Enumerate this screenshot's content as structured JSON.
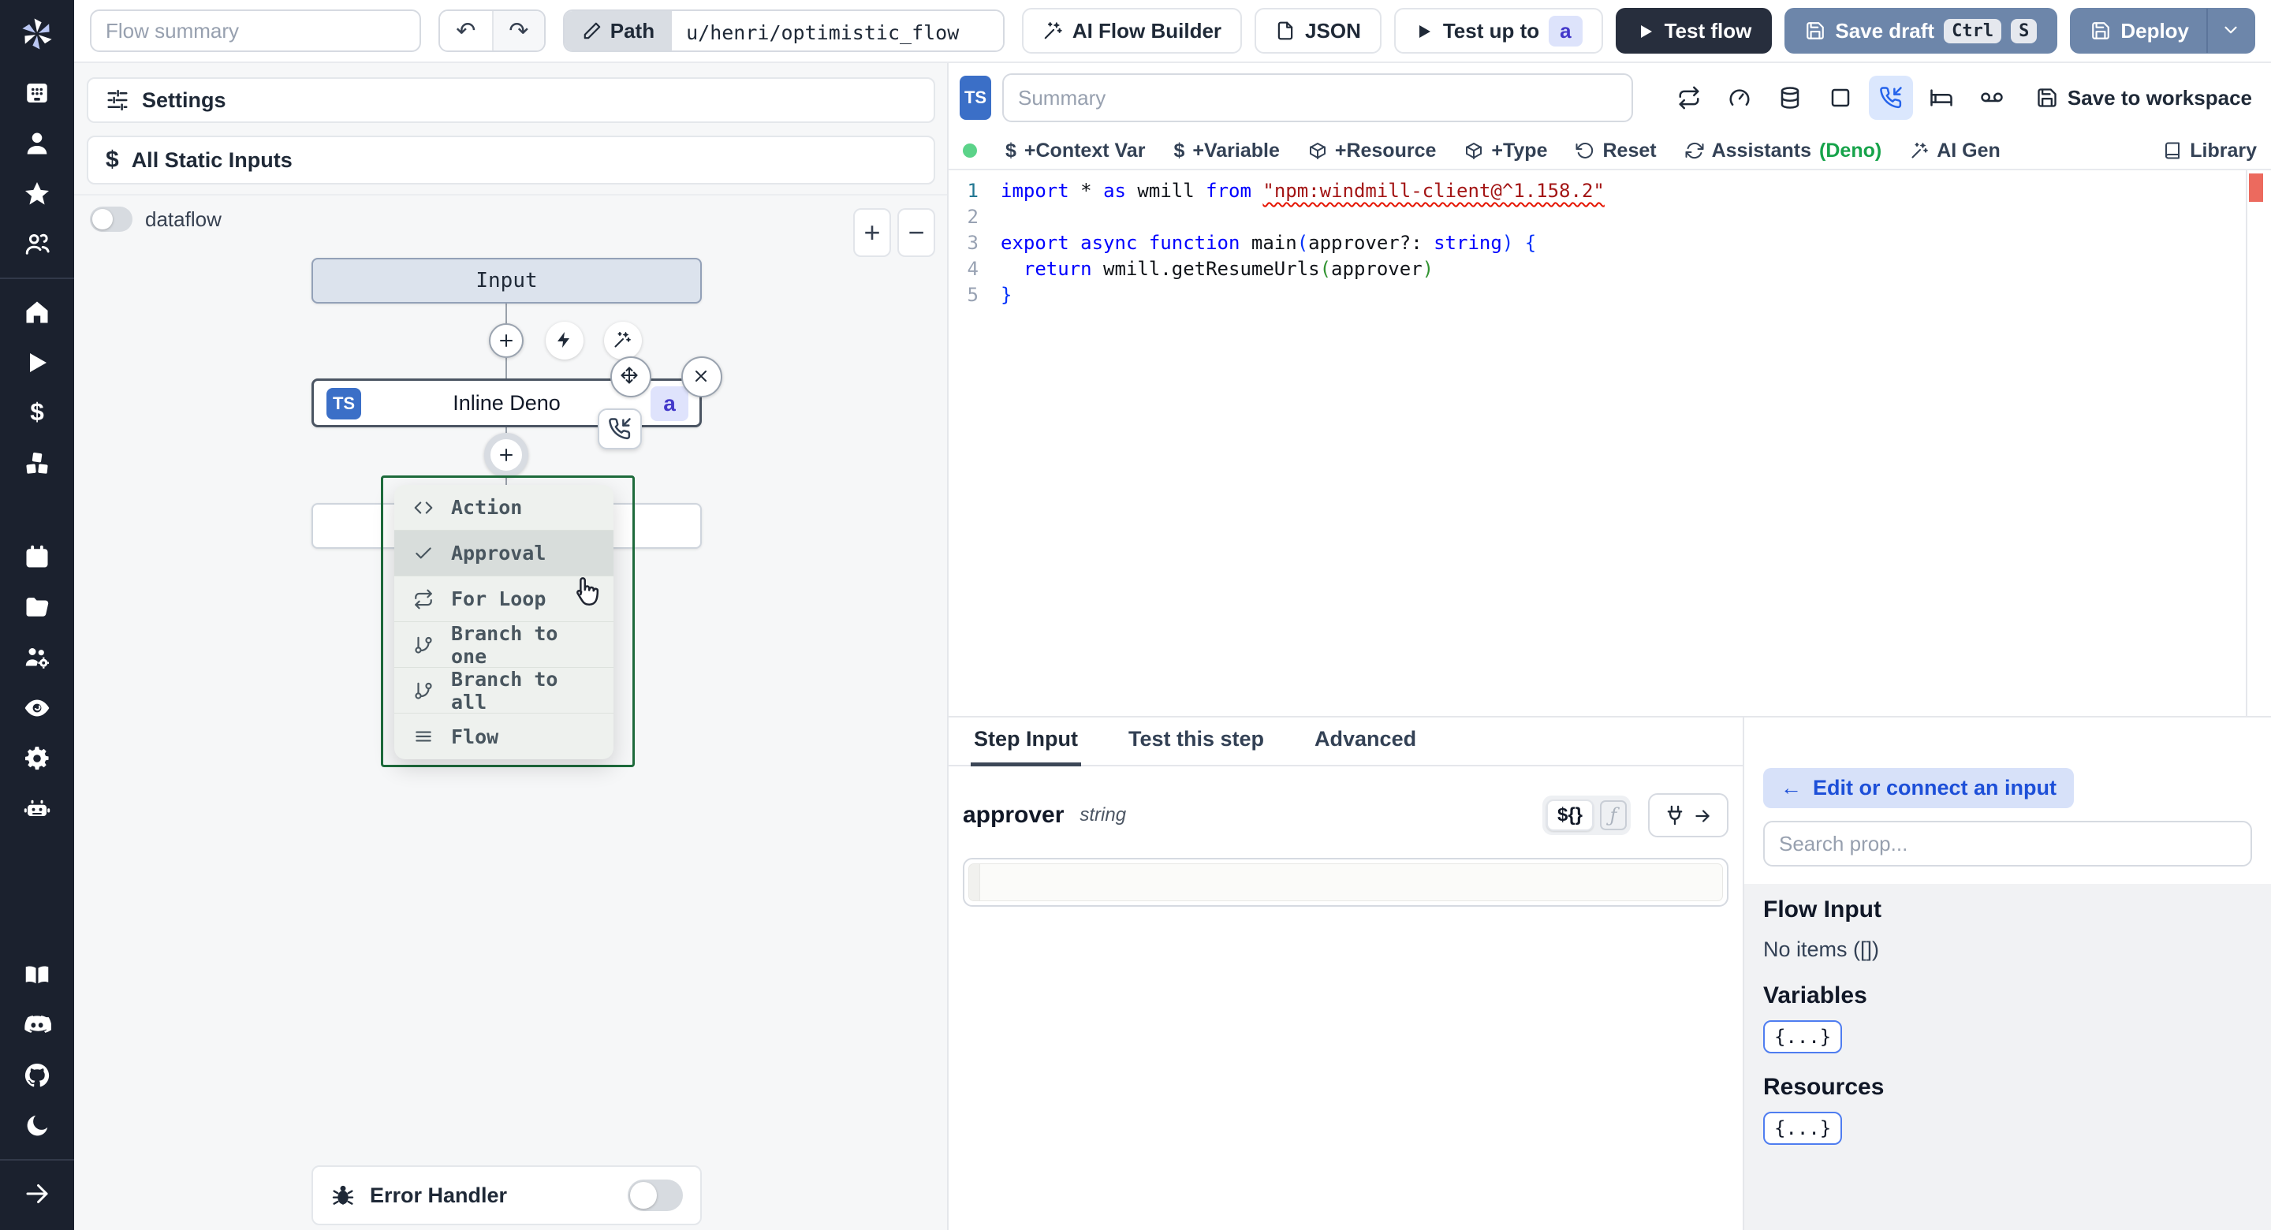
{
  "topbar": {
    "flow_summary_placeholder": "Flow summary",
    "undo_glyph": "↶",
    "redo_glyph": "↷",
    "path_label": "Path",
    "path_value": "u/henri/optimistic_flow",
    "ai_flow_builder": "AI Flow Builder",
    "json_label": "JSON",
    "test_up_to": "Test up to",
    "test_up_to_badge": "a",
    "test_flow": "Test flow",
    "save_draft": "Save draft",
    "kbd": [
      "Ctrl",
      "S"
    ],
    "deploy": "Deploy"
  },
  "colors": {
    "accent_slate_button": "#6d86aa",
    "dark_button": "#272e3d",
    "sidebar_bg": "#1b212e",
    "badge_indigo_bg": "#dde3fb",
    "badge_indigo_text": "#4338ca",
    "menu_outline_green": "#1e6b3c",
    "suspend_active_bg": "#dbe7fd",
    "deno_green": "#16a34a",
    "status_dot_green": "#5bd389",
    "error_marker_red": "#ec6a5e"
  },
  "sidebar": {
    "groups": [
      [
        "grid",
        "user",
        "star",
        "users"
      ],
      [
        "home",
        "play",
        "dollar",
        "boxes"
      ],
      [
        "calendar",
        "folder",
        "users-gear",
        "eye",
        "gear",
        "bot"
      ],
      [
        "book-open",
        "discord",
        "github",
        "moon"
      ],
      [
        "arrow-right"
      ]
    ]
  },
  "flow_panel": {
    "settings": "Settings",
    "all_static_inputs": "All Static Inputs",
    "dataflow": "dataflow",
    "zoom_in": "+",
    "zoom_out": "−",
    "input_node": "Input",
    "deno_node": "Inline Deno",
    "deno_ts_badge": "TS",
    "deno_id_badge": "a",
    "menu_items": [
      {
        "icon": "code",
        "label": "Action",
        "selected": false
      },
      {
        "icon": "check",
        "label": "Approval",
        "selected": true
      },
      {
        "icon": "repeat",
        "label": "For Loop",
        "selected": false
      },
      {
        "icon": "git-branch",
        "label": "Branch to one",
        "selected": false
      },
      {
        "icon": "git-branch",
        "label": "Branch to all",
        "selected": false
      },
      {
        "icon": "menu",
        "label": "Flow",
        "selected": false
      }
    ],
    "error_handler": "Error Handler"
  },
  "editor": {
    "ts_badge": "TS",
    "summary_placeholder": "Summary",
    "header_icons": [
      {
        "icon": "repeat",
        "name": "retries",
        "active": false
      },
      {
        "icon": "gauge",
        "name": "early-stop",
        "active": false
      },
      {
        "icon": "database",
        "name": "cache",
        "active": false
      },
      {
        "icon": "square",
        "name": "mock",
        "active": false
      },
      {
        "icon": "phone-incoming",
        "name": "suspend",
        "active": true
      },
      {
        "icon": "bed",
        "name": "sleep",
        "active": false
      },
      {
        "icon": "voicemail",
        "name": "concurrency",
        "active": false
      }
    ],
    "save_to_workspace": "Save to workspace",
    "chips": [
      {
        "icon": "dollar",
        "label": "+Context Var"
      },
      {
        "icon": "dollar",
        "label": "+Variable"
      },
      {
        "icon": "package",
        "label": "+Resource"
      },
      {
        "icon": "package",
        "label": "+Type"
      },
      {
        "icon": "rotate-ccw",
        "label": "Reset"
      },
      {
        "icon": "refresh-cw",
        "label": "Assistants",
        "suffix": "(Deno)"
      },
      {
        "icon": "wand",
        "label": "AI Gen"
      }
    ],
    "library": "Library",
    "code": {
      "lines": [
        {
          "n": "1",
          "tokens": [
            {
              "t": "import",
              "c": "kw"
            },
            {
              "t": " * ",
              "c": "pl"
            },
            {
              "t": "as",
              "c": "kw"
            },
            {
              "t": " wmill ",
              "c": "pl"
            },
            {
              "t": "from",
              "c": "kw"
            },
            {
              "t": " ",
              "c": "pl"
            },
            {
              "t": "\"npm:windmill-client@^1.158.2\"",
              "c": "str sq"
            }
          ]
        },
        {
          "n": "2",
          "tokens": []
        },
        {
          "n": "3",
          "tokens": [
            {
              "t": "export",
              "c": "kw"
            },
            {
              "t": " ",
              "c": "pl"
            },
            {
              "t": "async",
              "c": "kw"
            },
            {
              "t": " ",
              "c": "pl"
            },
            {
              "t": "function",
              "c": "kw"
            },
            {
              "t": " main",
              "c": "pl"
            },
            {
              "t": "(",
              "c": "b1"
            },
            {
              "t": "approver?: ",
              "c": "pl"
            },
            {
              "t": "string",
              "c": "kw"
            },
            {
              "t": ")",
              "c": "b1"
            },
            {
              "t": " ",
              "c": "pl"
            },
            {
              "t": "{",
              "c": "b1"
            }
          ]
        },
        {
          "n": "4",
          "tokens": [
            {
              "t": "  ",
              "c": "pl"
            },
            {
              "t": "return",
              "c": "kw"
            },
            {
              "t": " wmill.getResumeUrls",
              "c": "pl"
            },
            {
              "t": "(",
              "c": "b2"
            },
            {
              "t": "approver",
              "c": "pl"
            },
            {
              "t": ")",
              "c": "b2"
            }
          ]
        },
        {
          "n": "5",
          "tokens": [
            {
              "t": "}",
              "c": "b1"
            }
          ]
        }
      ]
    }
  },
  "step_panel": {
    "tabs": [
      {
        "label": "Step Input",
        "active": true
      },
      {
        "label": "Test this step",
        "active": false
      },
      {
        "label": "Advanced",
        "active": false
      }
    ],
    "field_name": "approver",
    "field_type": "string",
    "static_toggle": "${}",
    "js_toggle": "ƒ",
    "field_value": ""
  },
  "connect_panel": {
    "edit_button_arrow": "←",
    "edit_button": "Edit or connect an input",
    "search_placeholder": "Search prop...",
    "flow_input": "Flow Input",
    "no_items": "No items ([])",
    "variables": "Variables",
    "resources": "Resources",
    "brace_badge": "{...}"
  }
}
